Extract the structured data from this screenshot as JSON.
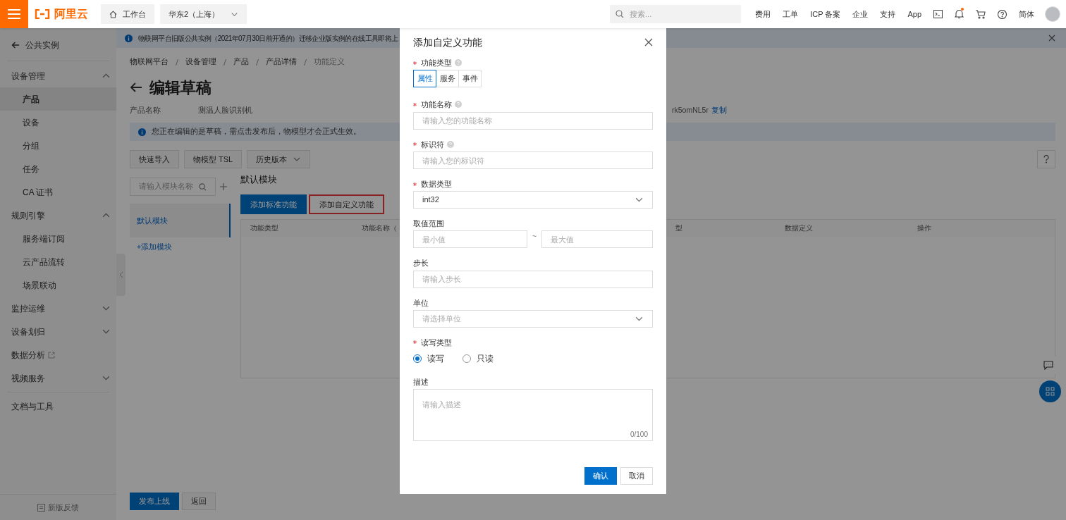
{
  "topbar": {
    "logo": "阿里云",
    "workbench": "工作台",
    "region": "华东2（上海）",
    "search_placeholder": "搜索...",
    "links": [
      "费用",
      "工单",
      "ICP 备案",
      "企业",
      "支持",
      "App"
    ],
    "has_notification": true,
    "language": "简体"
  },
  "sidebar": {
    "back": "公共实例",
    "items": [
      {
        "kind": "group",
        "label": "设备管理",
        "expanded": true,
        "children": [
          {
            "label": "产品",
            "selected": true
          },
          {
            "label": "设备",
            "selected": false
          },
          {
            "label": "分组",
            "selected": false
          },
          {
            "label": "任务",
            "selected": false
          },
          {
            "label": "CA 证书",
            "selected": false
          }
        ]
      },
      {
        "kind": "group",
        "label": "规则引擎",
        "expanded": true,
        "children": [
          {
            "label": "服务端订阅",
            "selected": false
          },
          {
            "label": "云产品流转",
            "selected": false
          },
          {
            "label": "场景联动",
            "selected": false
          }
        ]
      },
      {
        "kind": "group",
        "label": "监控运维",
        "expanded": false
      },
      {
        "kind": "group",
        "label": "设备划归",
        "expanded": false
      },
      {
        "kind": "external",
        "label": "数据分析"
      },
      {
        "kind": "group",
        "label": "视频服务",
        "expanded": false
      },
      {
        "kind": "footer_link",
        "label": "文档与工具"
      }
    ],
    "feedback": "新版反馈"
  },
  "banner": {
    "text": "物联网平台旧版公共实例（2021年07月30日前开通的）迁移企业版实例的在线工具即将上"
  },
  "breadcrumb": [
    "物联网平台",
    "设备管理",
    "产品",
    "产品详情",
    "功能定义"
  ],
  "title": "编辑草稿",
  "product": {
    "label": "产品名称",
    "name": "测温人脸识别机",
    "key_fragment": "rk5omNL5r",
    "copy": "复制"
  },
  "alert": "您正在编辑的是草稿，需点击发布后，物模型才会正式生效。",
  "toolbar": [
    {
      "label": "快速导入",
      "kind": "button"
    },
    {
      "label": "物模型 TSL",
      "kind": "button"
    },
    {
      "label": "历史版本",
      "kind": "dropdown"
    }
  ],
  "modules": {
    "search_placeholder": "请输入模块名称",
    "list": [
      {
        "label": "默认模块",
        "selected": true
      }
    ],
    "add": "+添加模块",
    "heading": "默认模块"
  },
  "actions": [
    {
      "label": "添加标准功能",
      "kind": "primary"
    },
    {
      "label": "添加自定义功能",
      "kind": "highlighted"
    }
  ],
  "table": {
    "columns": [
      "功能类型",
      "功能名称（",
      "型",
      "数据定义",
      "操作"
    ]
  },
  "footer_buttons": [
    {
      "label": "发布上线",
      "kind": "primary"
    },
    {
      "label": "返回",
      "kind": "default"
    }
  ],
  "dialog": {
    "title": "添加自定义功能",
    "function_type": {
      "label": "功能类型",
      "required": true,
      "help": true,
      "tabs": [
        {
          "label": "属性",
          "selected": true
        },
        {
          "label": "服务",
          "selected": false
        },
        {
          "label": "事件",
          "selected": false
        }
      ]
    },
    "fields": [
      {
        "kind": "text",
        "label": "功能名称",
        "required": true,
        "help": true,
        "placeholder": "请输入您的功能名称"
      },
      {
        "kind": "text",
        "label": "标识符",
        "required": true,
        "help": true,
        "placeholder": "请输入您的标识符"
      },
      {
        "kind": "select",
        "label": "数据类型",
        "required": true,
        "help": false,
        "value": "int32"
      },
      {
        "kind": "range",
        "label": "取值范围",
        "required": false,
        "help": false,
        "min_placeholder": "最小值",
        "separator": "~",
        "max_placeholder": "最大值"
      },
      {
        "kind": "text",
        "label": "步长",
        "required": false,
        "help": false,
        "placeholder": "请输入步长"
      },
      {
        "kind": "select",
        "label": "单位",
        "required": false,
        "help": false,
        "placeholder": "请选择单位"
      },
      {
        "kind": "radio",
        "label": "读写类型",
        "required": true,
        "help": false,
        "options": [
          {
            "label": "读写",
            "selected": true
          },
          {
            "label": "只读",
            "selected": false
          }
        ]
      },
      {
        "kind": "textarea",
        "label": "描述",
        "required": false,
        "help": false,
        "placeholder": "请输入描述",
        "counter": "0/100"
      }
    ],
    "buttons": [
      {
        "label": "确认",
        "kind": "primary"
      },
      {
        "label": "取消",
        "kind": "default"
      }
    ]
  }
}
